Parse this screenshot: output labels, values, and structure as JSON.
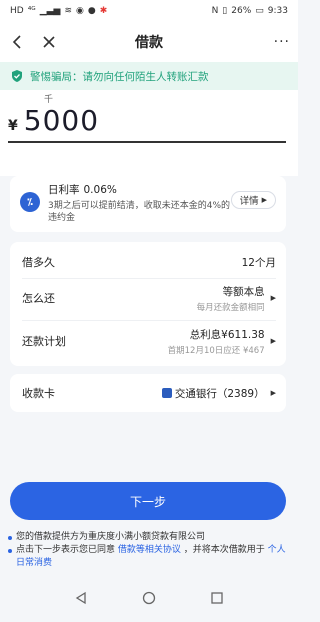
{
  "status_bar": {
    "left_icons": [
      "HD",
      "4G",
      "signal",
      "wifi",
      "wechat",
      "weibo",
      "hd-red"
    ],
    "battery": "26%",
    "time": "9:33"
  },
  "header": {
    "title": "借款",
    "back_icon": "chevron-left-icon",
    "close_icon": "close-icon",
    "more_label": "···"
  },
  "warning": {
    "text": "警惕骗局：请勿向任何陌生人转账汇款"
  },
  "amount": {
    "unit_hint": "千",
    "currency": "¥",
    "value": "5000"
  },
  "rate": {
    "icon_text": "⁒",
    "label": "日利率",
    "value": "0.06%",
    "desc": "3期之后可以提前结清，收取未还本金的4%的违约金",
    "detail_label": "详情"
  },
  "loan_info": {
    "term_label": "借多久",
    "term_value": "12个月",
    "repay_label": "怎么还",
    "repay_value": "等额本息",
    "repay_sub": "每月还款金额相同",
    "plan_label": "还款计划",
    "plan_value": "总利息¥611.38",
    "plan_sub": "首期12月10日应还 ¥467"
  },
  "receive_card": {
    "label": "收款卡",
    "bank": "交通银行（2389）"
  },
  "next_button": "下一步",
  "notes": {
    "line1": "您的借款提供方为重庆度小满小额贷款有限公司",
    "line2_prefix": "点击下一步表示您已同意",
    "line2_link": "借款等相关协议",
    "line2_suffix": "，并将本次借款用于",
    "line2_link2": "个人日常消费"
  },
  "colors": {
    "primary": "#2b64e3",
    "warning_green": "#21a27c",
    "warning_bg": "#e7f6f1"
  }
}
